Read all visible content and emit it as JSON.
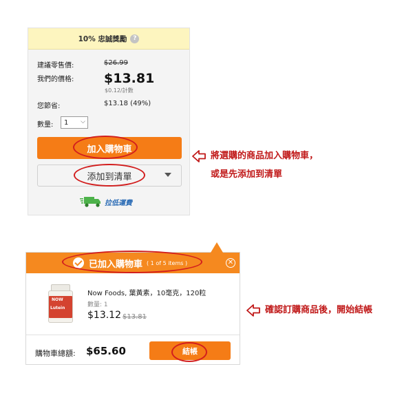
{
  "product_panel": {
    "loyalty_label": "10% 忠誠獎勵",
    "help_icon": "?",
    "msrp_label": "建議零售價:",
    "msrp_value": "$26.99",
    "our_price_label": "我們的價格:",
    "our_price_value": "$13.81",
    "unit_price": "$0.12/計數",
    "savings_label": "您節省:",
    "savings_value": "$13.18 (49%)",
    "qty_label": "數量:",
    "qty_selected": "1",
    "add_to_cart_label": "加入購物車",
    "add_to_list_label": "添加到清單",
    "shipping_label": "拉低運費"
  },
  "annotations": {
    "note_1_line1": "將選購的商品加入購物車，",
    "note_1_line2": "或是先添加到清單",
    "note_2": "確認訂購商品後，開始結帳"
  },
  "cart_popup": {
    "title": "已加入購物車",
    "count": "( 1 of 5 items )",
    "close_symbol": "✕",
    "product_name": "Now Foods, 葉黃素，10毫克，120粒",
    "product_qty": "數量: 1",
    "product_price": "$13.12",
    "product_old_price": "$13.81",
    "bottle_brand": "NOW",
    "bottle_name": "Lutein",
    "total_label": "購物車總額:",
    "total_value": "$65.60",
    "checkout_label": "結帳"
  },
  "colors": {
    "accent_orange": "#f57c16",
    "highlight_red": "#d21e1e",
    "loyalty_yellow": "#fdf5bf",
    "link_blue": "#2a6bb5"
  },
  "icons": [
    "help-icon",
    "chevron-down-icon",
    "dropdown-arrow-icon",
    "truck-icon",
    "left-arrow-icon",
    "check-circle-icon",
    "close-icon"
  ]
}
